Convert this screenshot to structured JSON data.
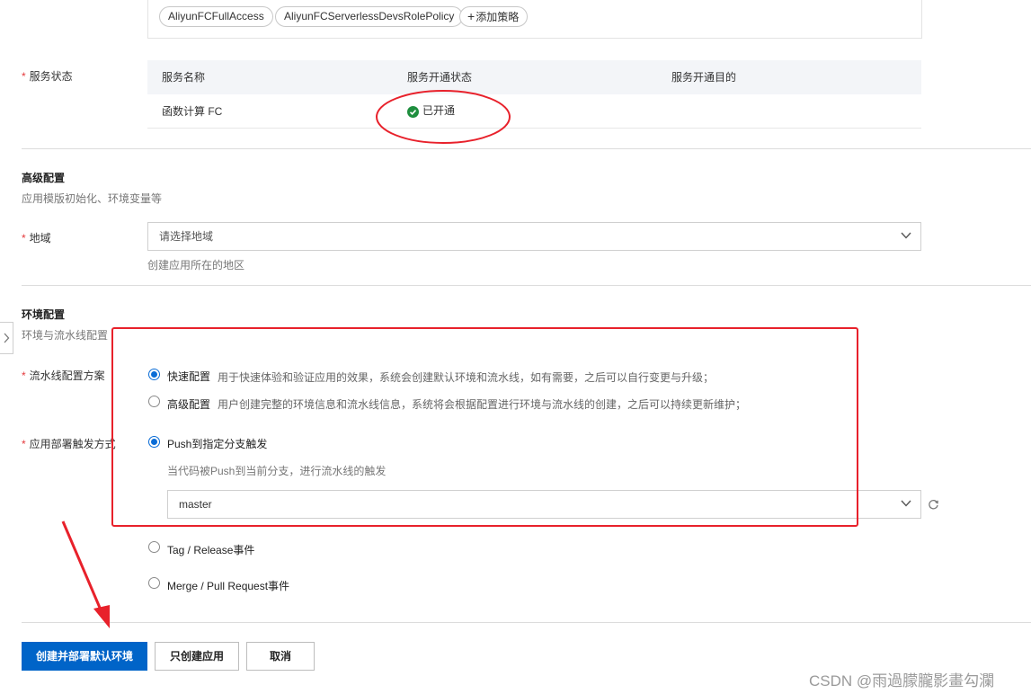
{
  "policies": {
    "tags": [
      "AliyunFCFullAccess",
      "AliyunFCServerlessDevsRolePolicy",
      "添加策略"
    ]
  },
  "service_status": {
    "label": "服务状态",
    "headers": [
      "服务名称",
      "服务开通状态",
      "服务开通目的"
    ],
    "row": {
      "name": "函数计算 FC",
      "status": "已开通",
      "purpose": ""
    }
  },
  "advanced": {
    "title": "高级配置",
    "desc": "应用模版初始化、环境变量等",
    "region_label": "地域",
    "region_placeholder": "请选择地域",
    "region_hint": "创建应用所在的地区"
  },
  "env": {
    "title": "环境配置",
    "desc": "环境与流水线配置",
    "pipeline_label": "流水线配置方案",
    "pipeline_options": [
      {
        "label": "快速配置",
        "desc": "用于快速体验和验证应用的效果，系统会创建默认环境和流水线，如有需要，之后可以自行变更与升级；",
        "selected": true
      },
      {
        "label": "高级配置",
        "desc": "用户创建完整的环境信息和流水线信息，系统将会根据配置进行环境与流水线的创建，之后可以持续更新维护；",
        "selected": false
      }
    ],
    "trigger_label": "应用部署触发方式",
    "trigger_options": [
      {
        "label": "Push到指定分支触发",
        "selected": true
      },
      {
        "label": "Tag / Release事件",
        "selected": false
      },
      {
        "label": "Merge / Pull Request事件",
        "selected": false
      }
    ],
    "push_hint": "当代码被Push到当前分支，进行流水线的触发",
    "branch_value": "master"
  },
  "actions": {
    "primary": "创建并部署默认环境",
    "create_only": "只创建应用",
    "cancel": "取消"
  },
  "watermark": "CSDN @雨過朦朧影畫勾瀾",
  "colors": {
    "primary": "#0064c8",
    "required_star": "#e4393c",
    "success": "#1e8e3e",
    "annotation_red": "#e8212b"
  }
}
